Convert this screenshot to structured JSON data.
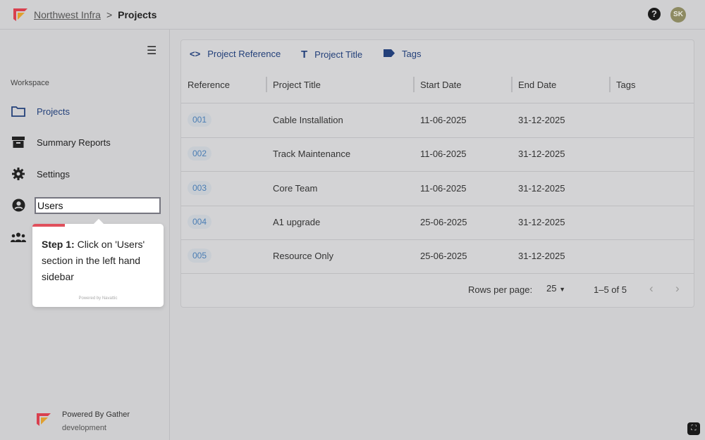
{
  "header": {
    "org": "Northwest Infra",
    "separator": ">",
    "page": "Projects",
    "avatar_initials": "SK",
    "help_icon": "?"
  },
  "sidebar": {
    "section": "Workspace",
    "items": [
      {
        "label": "Projects",
        "icon": "folder-icon"
      },
      {
        "label": "Summary Reports",
        "icon": "archive-icon"
      },
      {
        "label": "Settings",
        "icon": "gear-icon"
      },
      {
        "label": "Users",
        "icon": "user-circle-icon"
      },
      {
        "label": "",
        "icon": "group-icon"
      }
    ],
    "powered_by": "Powered By Gather",
    "environment": "development"
  },
  "tooltip": {
    "step": "Step 1:",
    "text": "Click on 'Users' section in the left hand sidebar",
    "powered": "Powered by Navattic",
    "accent": "#e0505c"
  },
  "toolbar": {
    "items": [
      {
        "label": "Project Reference",
        "icon": "code-icon"
      },
      {
        "label": "Project Title",
        "icon": "text-icon"
      },
      {
        "label": "Tags",
        "icon": "tag-icon"
      }
    ]
  },
  "table": {
    "columns": [
      "Reference",
      "Project Title",
      "Start Date",
      "End Date",
      "Tags"
    ],
    "rows": [
      {
        "ref": "001",
        "title": "Cable Installation",
        "start": "11-06-2025",
        "end": "31-12-2025",
        "tags": ""
      },
      {
        "ref": "002",
        "title": "Track Maintenance",
        "start": "11-06-2025",
        "end": "31-12-2025",
        "tags": ""
      },
      {
        "ref": "003",
        "title": "Core Team",
        "start": "11-06-2025",
        "end": "31-12-2025",
        "tags": ""
      },
      {
        "ref": "004",
        "title": "A1 upgrade",
        "start": "25-06-2025",
        "end": "31-12-2025",
        "tags": ""
      },
      {
        "ref": "005",
        "title": "Resource Only",
        "start": "25-06-2025",
        "end": "31-12-2025",
        "tags": ""
      }
    ]
  },
  "pagination": {
    "rows_label": "Rows per page:",
    "rows_value": "25",
    "range": "1–5 of 5"
  }
}
